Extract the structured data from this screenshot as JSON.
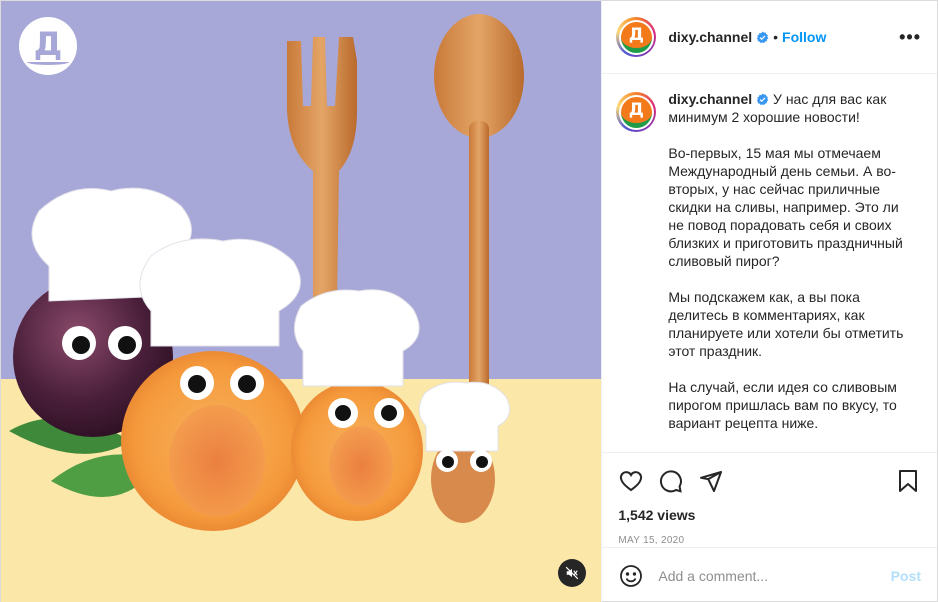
{
  "account": {
    "username": "dixy.channel",
    "follow_label": "Follow",
    "dot": "•",
    "avatar_letter": "Д"
  },
  "media": {
    "logo_letter": "Д",
    "mute_icon": "speaker-muted-icon"
  },
  "header": {
    "more_label": "•••"
  },
  "caption": {
    "username": "dixy.channel",
    "paragraphs": [
      "У нас для вас как минимум 2 хорошие новости!",
      "Во-первых, 15 мая мы отмечаем Международный день семьи. А во-вторых, у нас сейчас приличные скидки на сливы, например. Это ли не повод порадовать себя и своих близких и приготовить праздничный сливовый пирог?",
      "Мы подскажем как, а вы пока делитесь в комментариях, как планируете или хотели бы отметить этот праздник.",
      "На случай, если идея со сливовым пирогом пришлась вам по вкусу, то вариант рецепта ниже."
    ]
  },
  "stats": {
    "views": "1,542 views",
    "date": "MAY 15, 2020"
  },
  "comment_box": {
    "placeholder": "Add a comment...",
    "post_label": "Post"
  },
  "colors": {
    "accent": "#0095f6",
    "post_disabled": "#b2dffc",
    "brand_orange": "#f27a1a",
    "background_purple": "#a8a8d8",
    "table_yellow": "#fbe7a8"
  }
}
